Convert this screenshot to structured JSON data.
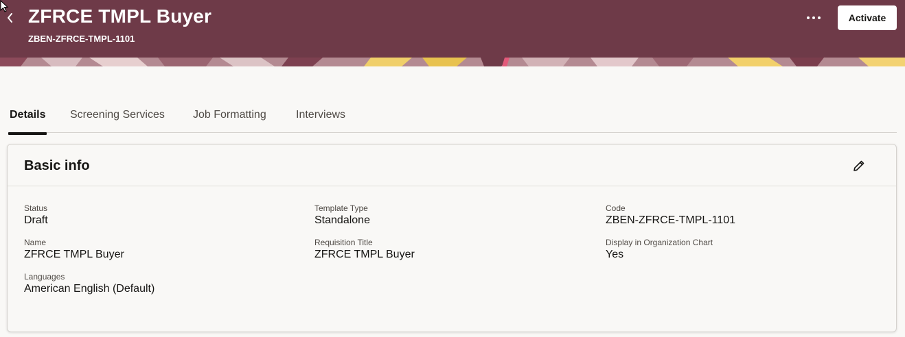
{
  "header": {
    "title": "ZFRCE TMPL Buyer",
    "subtitle": "ZBEN-ZFRCE-TMPL-1101",
    "back_icon": "chevron-left-icon",
    "more_icon": "more-horizontal-icon",
    "activate_label": "Activate",
    "background_color": "#6e3a48"
  },
  "tabs": [
    {
      "label": "Details",
      "active": true
    },
    {
      "label": "Screening Services",
      "active": false
    },
    {
      "label": "Job Formatting",
      "active": false
    },
    {
      "label": "Interviews",
      "active": false
    }
  ],
  "card": {
    "title": "Basic info",
    "edit_icon": "pencil-icon",
    "fields": {
      "status": {
        "label": "Status",
        "value": "Draft"
      },
      "template_type": {
        "label": "Template Type",
        "value": "Standalone"
      },
      "code": {
        "label": "Code",
        "value": "ZBEN-ZFRCE-TMPL-1101"
      },
      "name": {
        "label": "Name",
        "value": "ZFRCE TMPL Buyer"
      },
      "requisition_title": {
        "label": "Requisition Title",
        "value": "ZFRCE TMPL Buyer"
      },
      "display_org_chart": {
        "label": "Display in Organization Chart",
        "value": "Yes"
      },
      "languages": {
        "label": "Languages",
        "value": "American English (Default)"
      }
    }
  }
}
